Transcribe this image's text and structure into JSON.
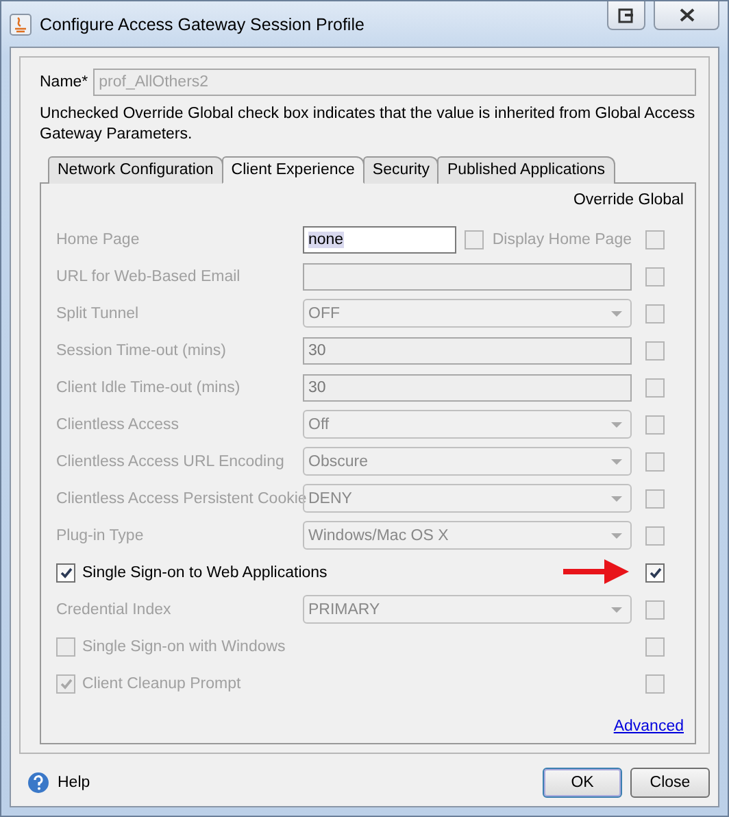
{
  "window": {
    "title": "Configure Access Gateway Session Profile"
  },
  "name_field": {
    "label": "Name*",
    "value": "prof_AllOthers2",
    "disabled": true
  },
  "note": "Unchecked Override Global check box indicates that the value is inherited from Global Access Gateway Parameters.",
  "tabs": [
    {
      "label": "Network Configuration",
      "selected": false
    },
    {
      "label": "Client Experience",
      "selected": true
    },
    {
      "label": "Security",
      "selected": false
    },
    {
      "label": "Published Applications",
      "selected": false
    }
  ],
  "override_header": "Override Global",
  "rows": [
    {
      "kind": "text",
      "label": "Home Page",
      "value": "none",
      "extra_checkbox": {
        "label": "Display Home Page",
        "checked": false
      },
      "disabled": true,
      "override": false,
      "arrow": false
    },
    {
      "kind": "text",
      "label": "URL for Web-Based Email",
      "disabled": true,
      "override": false,
      "arrow": false
    },
    {
      "kind": "select",
      "label": "Split Tunnel",
      "value": "OFF",
      "disabled": true,
      "override": false,
      "arrow": false
    },
    {
      "kind": "text",
      "label": "Session Time-out (mins)",
      "value": "30",
      "disabled": true,
      "override": false,
      "arrow": false
    },
    {
      "kind": "text",
      "label": "Client Idle Time-out (mins)",
      "value": "30",
      "disabled": true,
      "override": false,
      "arrow": false
    },
    {
      "kind": "select",
      "label": "Clientless Access",
      "value": "Off",
      "disabled": true,
      "override": false,
      "arrow": false
    },
    {
      "kind": "select",
      "label": "Clientless Access URL Encoding",
      "value": "Obscure",
      "disabled": true,
      "override": false,
      "arrow": false
    },
    {
      "kind": "select",
      "label": "Clientless Access Persistent Cookie",
      "value": "DENY",
      "disabled": true,
      "override": false,
      "arrow": false
    },
    {
      "kind": "select",
      "label": "Plug-in Type",
      "value": "Windows/Mac OS X",
      "disabled": true,
      "override": false,
      "arrow": false
    },
    {
      "kind": "checkbox",
      "label": "Single Sign-on to Web Applications",
      "checked": true,
      "disabled": false,
      "override": true,
      "arrow": true
    },
    {
      "kind": "select",
      "label": "Credential Index",
      "value": "PRIMARY",
      "disabled": true,
      "override": false,
      "arrow": false
    },
    {
      "kind": "checkbox",
      "label": "Single Sign-on with Windows",
      "checked": false,
      "disabled": true,
      "override": false,
      "arrow": false
    },
    {
      "kind": "checkbox",
      "label": "Client Cleanup Prompt",
      "checked": true,
      "disabled": true,
      "override": false,
      "arrow": false
    }
  ],
  "advanced_link": "Advanced",
  "help": "Help",
  "buttons": [
    {
      "label": "OK",
      "default": true
    },
    {
      "label": "Close",
      "default": false
    }
  ]
}
